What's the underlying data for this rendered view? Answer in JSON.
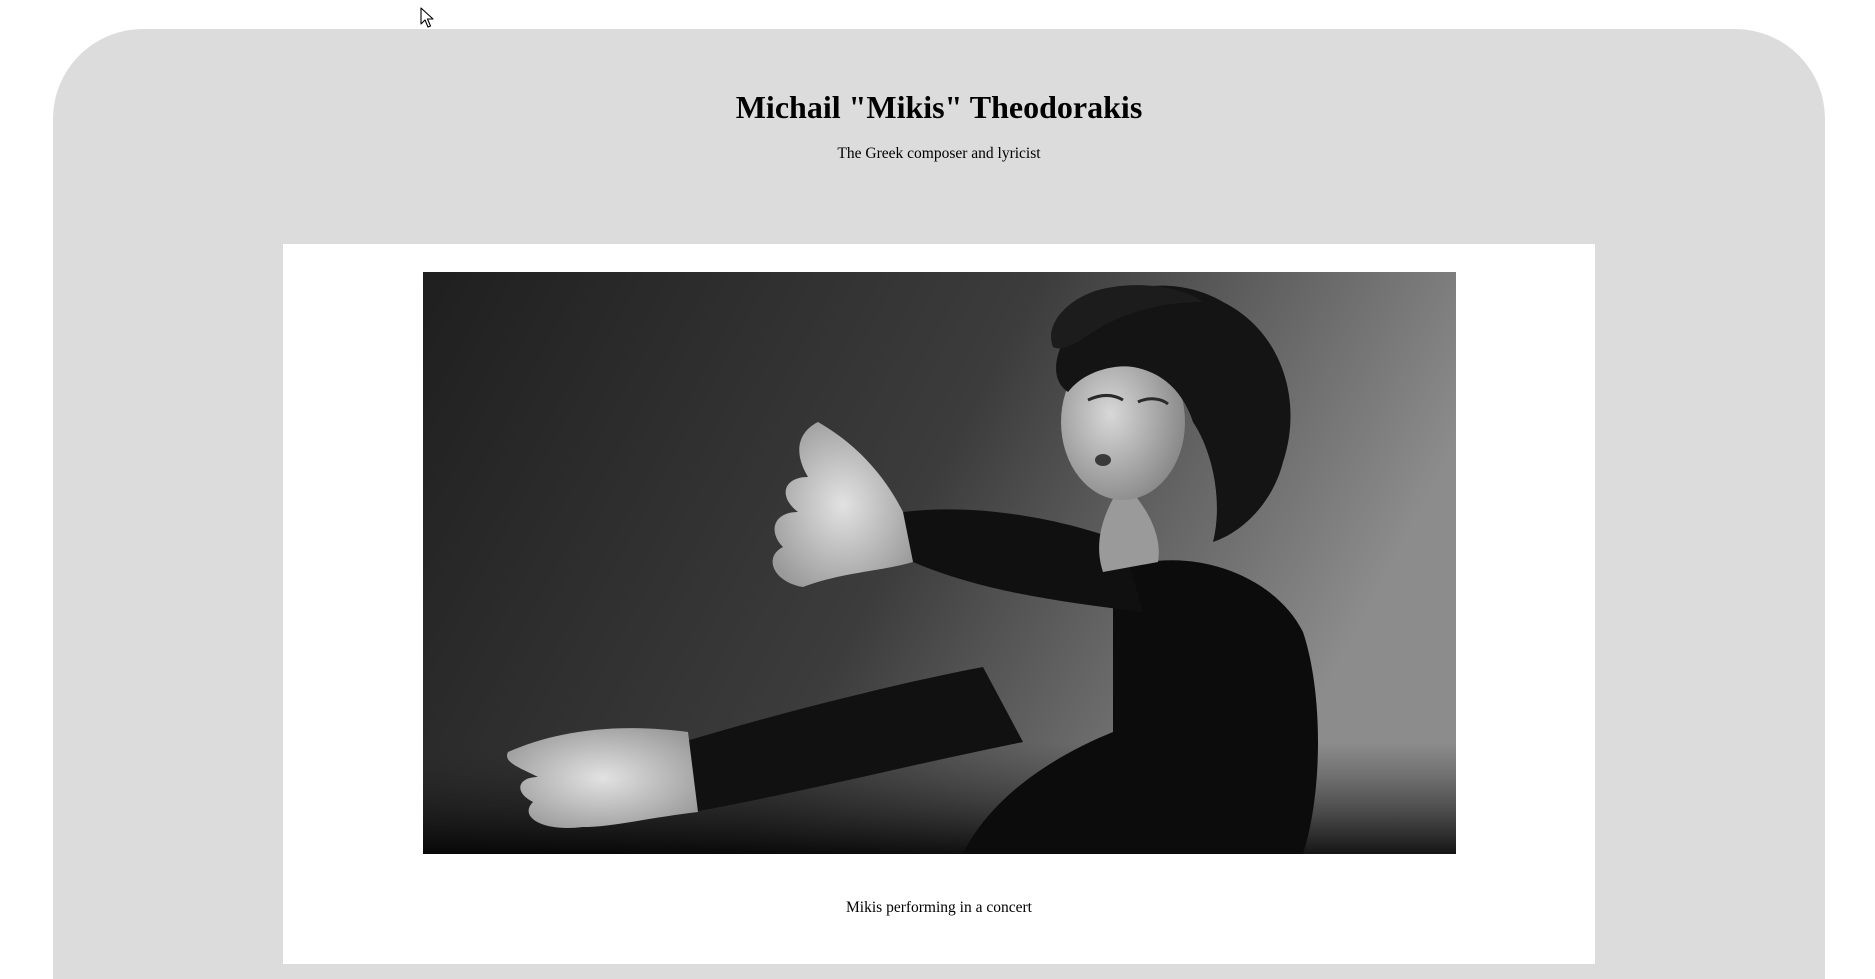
{
  "header": {
    "title": "Michail \"Mikis\" Theodorakis",
    "subtitle": "The Greek composer and lyricist"
  },
  "figure": {
    "caption": "Mikis performing in a concert"
  },
  "colors": {
    "page_background": "#ffffff",
    "panel_background": "#dcdcdc",
    "card_background": "#ffffff",
    "text": "#000000"
  },
  "icons": {
    "cursor": "mouse-pointer-icon"
  }
}
